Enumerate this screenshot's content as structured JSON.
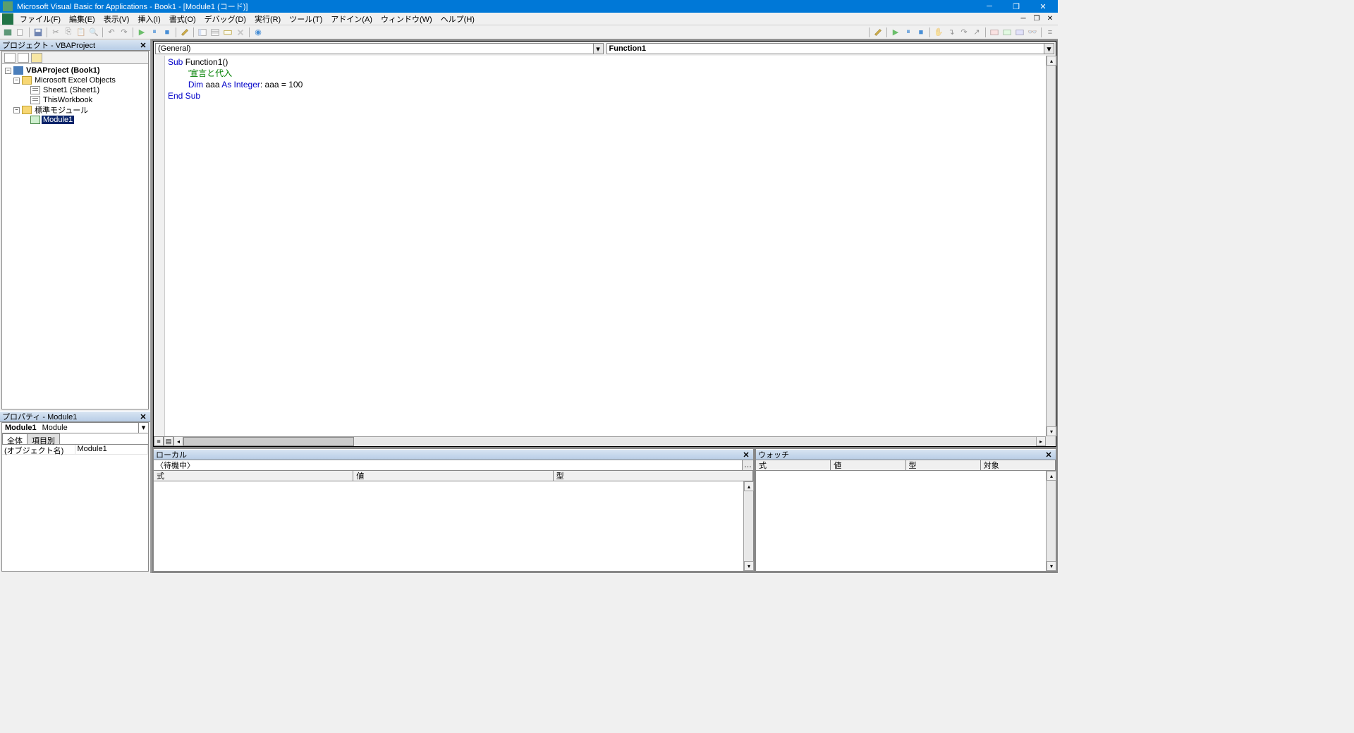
{
  "title": "Microsoft Visual Basic for Applications - Book1 - [Module1 (コード)]",
  "menu": [
    "ファイル(F)",
    "編集(E)",
    "表示(V)",
    "挿入(I)",
    "書式(O)",
    "デバッグ(D)",
    "実行(R)",
    "ツール(T)",
    "アドイン(A)",
    "ウィンドウ(W)",
    "ヘルプ(H)"
  ],
  "project_panel_title": "プロジェクト - VBAProject",
  "tree": {
    "root": "VBAProject (Book1)",
    "excel_objects": "Microsoft Excel Objects",
    "sheet1": "Sheet1 (Sheet1)",
    "thisworkbook": "ThisWorkbook",
    "std_modules": "標準モジュール",
    "module1": "Module1"
  },
  "properties_panel_title": "プロパティ - Module1",
  "prop_selector_name": "Module1",
  "prop_selector_type": "Module",
  "prop_tabs": [
    "全体",
    "項目別"
  ],
  "prop_row_name": "(オブジェクト名)",
  "prop_row_value": "Module1",
  "code_dd_object": "(General)",
  "code_dd_proc": "Function1",
  "code": {
    "l1_kw": "Sub ",
    "l1_rest": "Function1()",
    "l2_cm": "'宣言と代入",
    "l3_kw1": "Dim ",
    "l3_var": "aaa ",
    "l3_kw2": "As Integer",
    "l3_rest": ": aaa = 100",
    "l4_kw": "End Sub"
  },
  "locals_title": "ローカル",
  "locals_ready": "〈待機中〉",
  "locals_cols": [
    "式",
    "値",
    "型"
  ],
  "watch_title": "ウォッチ",
  "watch_cols": [
    "式",
    "値",
    "型",
    "対象"
  ]
}
